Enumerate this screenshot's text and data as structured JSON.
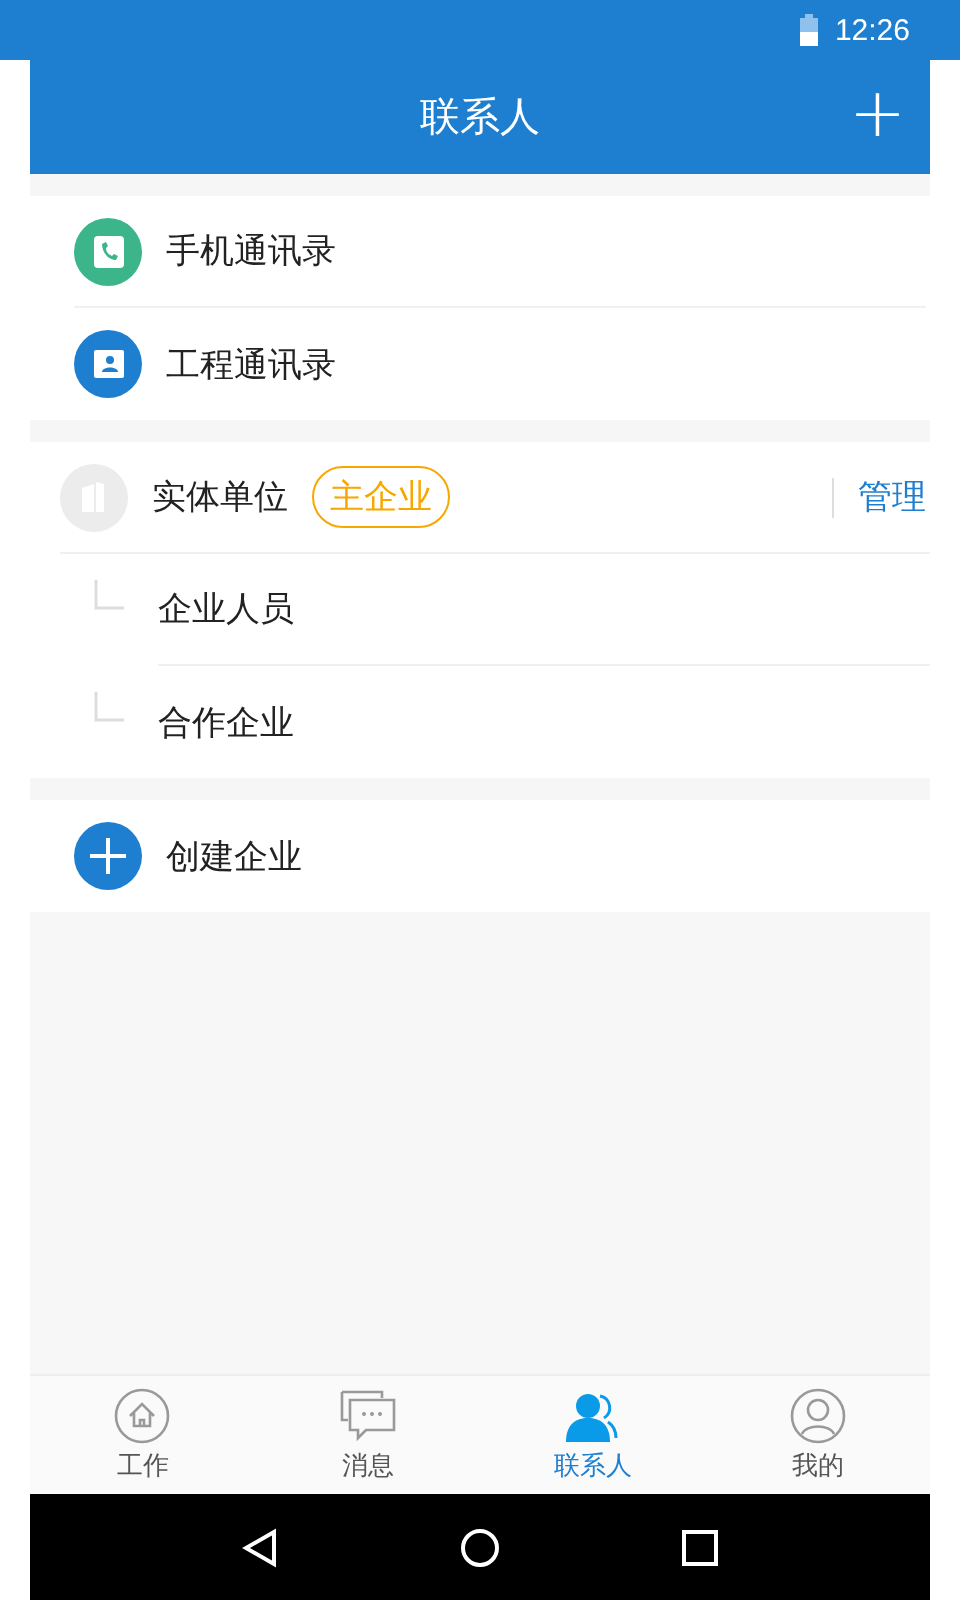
{
  "status_bar": {
    "time": "12:26"
  },
  "header": {
    "title": "联系人",
    "action": "+"
  },
  "directories": [
    {
      "label": "手机通讯录",
      "kind": "phone"
    },
    {
      "label": "工程通讯录",
      "kind": "project"
    }
  ],
  "enterprise": {
    "name": "实体单位",
    "badge": "主企业",
    "manage": "管理",
    "children": [
      {
        "label": "企业人员"
      },
      {
        "label": "合作企业"
      }
    ]
  },
  "create": {
    "label": "创建企业"
  },
  "tabs": [
    {
      "label": "工作",
      "kind": "home",
      "selected": false
    },
    {
      "label": "消息",
      "kind": "chat",
      "selected": false
    },
    {
      "label": "联系人",
      "kind": "contacts",
      "selected": true
    },
    {
      "label": "我的",
      "kind": "profile",
      "selected": false
    }
  ]
}
